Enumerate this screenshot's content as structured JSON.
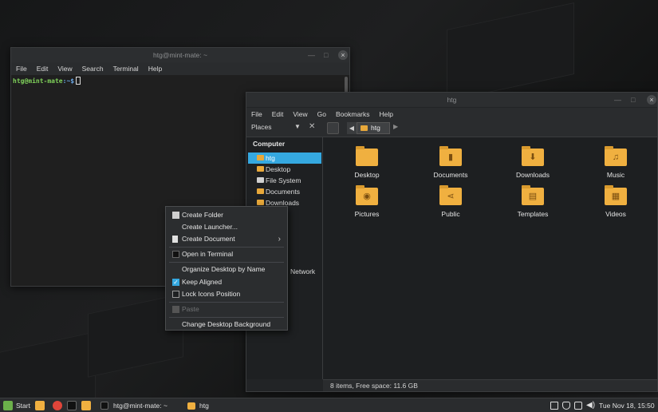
{
  "terminal": {
    "title": "htg@mint-mate: ~",
    "menu": [
      "File",
      "Edit",
      "View",
      "Search",
      "Terminal",
      "Help"
    ],
    "prompt_user": "htg@mint-mate",
    "prompt_path": ":~$"
  },
  "filemanager": {
    "title": "htg",
    "menu": [
      "File",
      "Edit",
      "View",
      "Go",
      "Bookmarks",
      "Help"
    ],
    "places_label": "Places",
    "breadcrumb": "htg",
    "sidebar_heading": "Computer",
    "sidebar_items": [
      {
        "label": "htg",
        "icon": "home-folder-icon",
        "selected": true
      },
      {
        "label": "Desktop",
        "icon": "folder-icon"
      },
      {
        "label": "File System",
        "icon": "drive-icon"
      },
      {
        "label": "Documents",
        "icon": "folder-icon"
      },
      {
        "label": "Downloads",
        "icon": "folder-icon"
      }
    ],
    "sidebar_partial_network": "Network",
    "items": [
      {
        "label": "Desktop",
        "glyph": ""
      },
      {
        "label": "Documents",
        "glyph": "▮"
      },
      {
        "label": "Downloads",
        "glyph": "⬇"
      },
      {
        "label": "Music",
        "glyph": "♫"
      },
      {
        "label": "Pictures",
        "glyph": "◉"
      },
      {
        "label": "Public",
        "glyph": "⋖"
      },
      {
        "label": "Templates",
        "glyph": "▤"
      },
      {
        "label": "Videos",
        "glyph": "▦"
      }
    ],
    "status": "8 items, Free space: 11.6 GB"
  },
  "context_menu": {
    "create_folder": "Create Folder",
    "create_launcher": "Create Launcher...",
    "create_document": "Create Document",
    "open_terminal": "Open in Terminal",
    "organize": "Organize Desktop by Name",
    "keep_aligned": "Keep Aligned",
    "keep_aligned_checked": true,
    "lock_icons": "Lock Icons Position",
    "lock_icons_checked": false,
    "paste": "Paste",
    "change_background": "Change Desktop Background"
  },
  "taskbar": {
    "start_label": "Start",
    "task_terminal": "htg@mint-mate: ~",
    "task_files": "htg",
    "clock": "Tue Nov 18, 15:50"
  },
  "colors": {
    "accent": "#35a8e0",
    "folder": "#f0b040",
    "prompt_user": "#7fd15a",
    "prompt_path": "#6aa8e8"
  }
}
